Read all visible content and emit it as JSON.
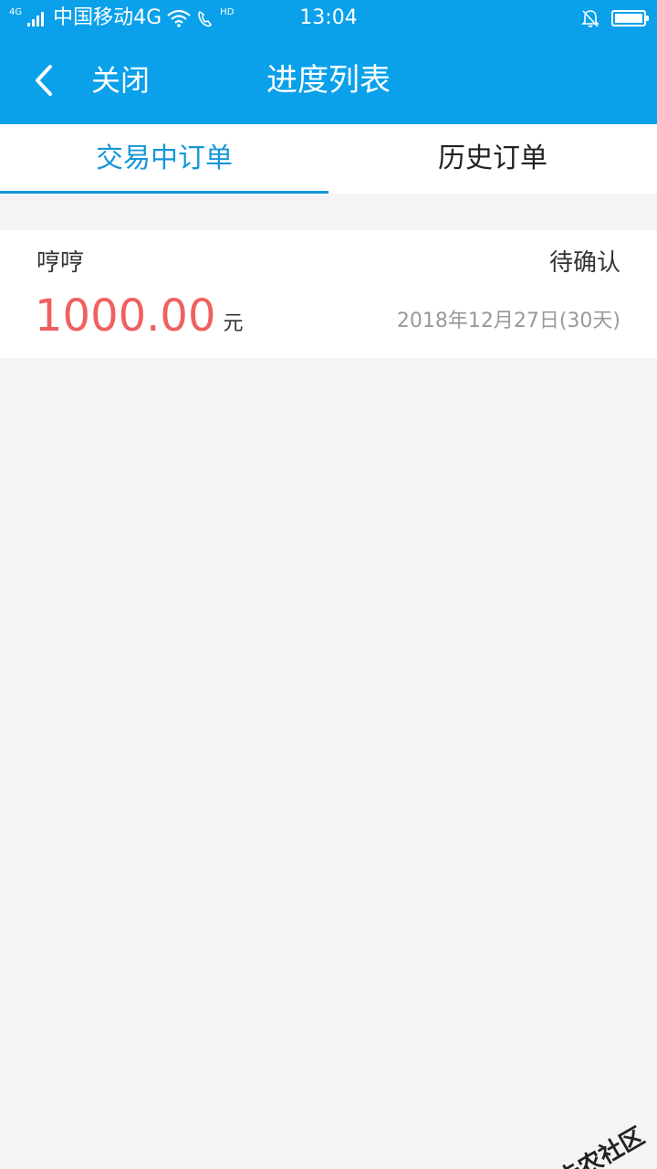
{
  "status_bar": {
    "net_small": "4G",
    "carrier": "中国移动4G",
    "hd": "HD",
    "time": "13:04"
  },
  "nav": {
    "close_label": "关闭",
    "title": "进度列表"
  },
  "tabs": [
    {
      "label": "交易中订单",
      "active": true
    },
    {
      "label": "历史订单",
      "active": false
    }
  ],
  "order": {
    "name": "哼哼",
    "status": "待确认",
    "amount": "1000.00",
    "unit": "元",
    "date": "2018年12月27日(30天)"
  },
  "colors": {
    "primary": "#0aa0ea",
    "tab_active": "#1596d8",
    "amount": "#f06060",
    "background": "#f4f4f4"
  },
  "watermark": {
    "text": "卡农社区"
  }
}
